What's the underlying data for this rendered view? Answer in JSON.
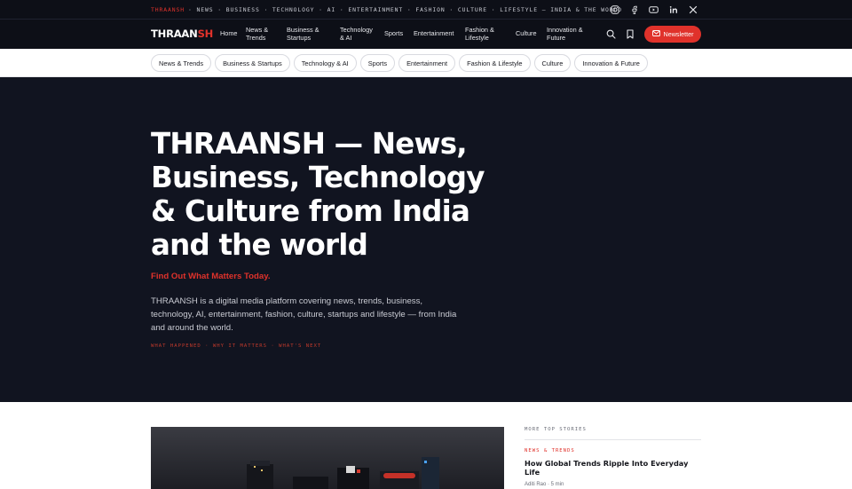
{
  "topbar": {
    "brand": "THRAANSH",
    "ticker": "· NEWS · BUSINESS · TECHNOLOGY · AI · ENTERTAINMENT · FASHION · CULTURE · LIFESTYLE — INDIA & THE WORLD",
    "socials": [
      "instagram-icon",
      "facebook-icon",
      "youtube-icon",
      "linkedin-icon",
      "x-icon"
    ]
  },
  "nav": {
    "logo_main": "THRAAN",
    "logo_accent": "SH",
    "links": [
      "Home",
      "News & Trends",
      "Business & Startups",
      "Technology & AI",
      "Sports",
      "Entertainment",
      "Fashion & Lifestyle",
      "Culture",
      "Innovation & Future"
    ],
    "newsletter_label": "Newsletter"
  },
  "categories": [
    "News & Trends",
    "Business & Startups",
    "Technology & AI",
    "Sports",
    "Entertainment",
    "Fashion & Lifestyle",
    "Culture",
    "Innovation & Future"
  ],
  "hero": {
    "title": "THRAANSH — News, Business, Technology & Culture from India and the world",
    "tagline": "Find Out What Matters Today.",
    "description": "THRAANSH is a digital media platform covering news, trends, business, technology, AI, entertainment, fashion, culture, startups and lifestyle — from India and around the world.",
    "chips": "WHAT HAPPENED · WHY IT MATTERS · WHAT'S NEXT"
  },
  "sidebar": {
    "heading": "MORE TOP STORIES",
    "kicker": "NEWS & TRENDS",
    "story_title": "How Global Trends Ripple Into Everyday Life",
    "meta": "Aditi Rao · 5 min"
  },
  "colors": {
    "accent": "#e0322b",
    "hero_bg": "#111420",
    "nav_bg": "#0d0f17"
  }
}
